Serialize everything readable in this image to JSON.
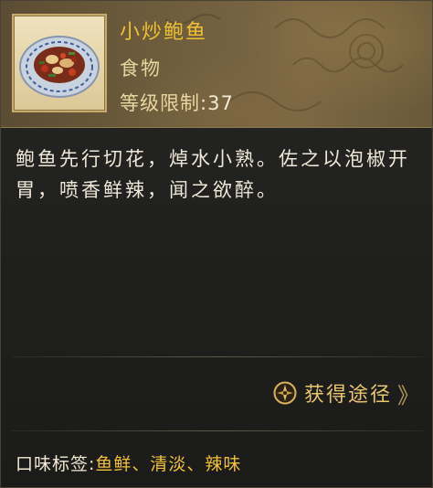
{
  "item": {
    "name": "小炒鲍鱼",
    "type": "食物",
    "level_label": "等级限制",
    "level_sep": ":",
    "level_value": "37"
  },
  "description": "鲍鱼先行切花，焯水小熟。佐之以泡椒开胃，喷香鲜辣，闻之欲醉。",
  "source": {
    "label": "获得途径",
    "icon": "compass-icon",
    "arrow": "》"
  },
  "taste": {
    "label": "口味标签:",
    "values": "鱼鲜、清淡、辣味"
  },
  "colors": {
    "title": "#f0c233",
    "accent_text": "#e8d6a0",
    "link": "#e9c56e",
    "body_text": "#efe8d8"
  }
}
